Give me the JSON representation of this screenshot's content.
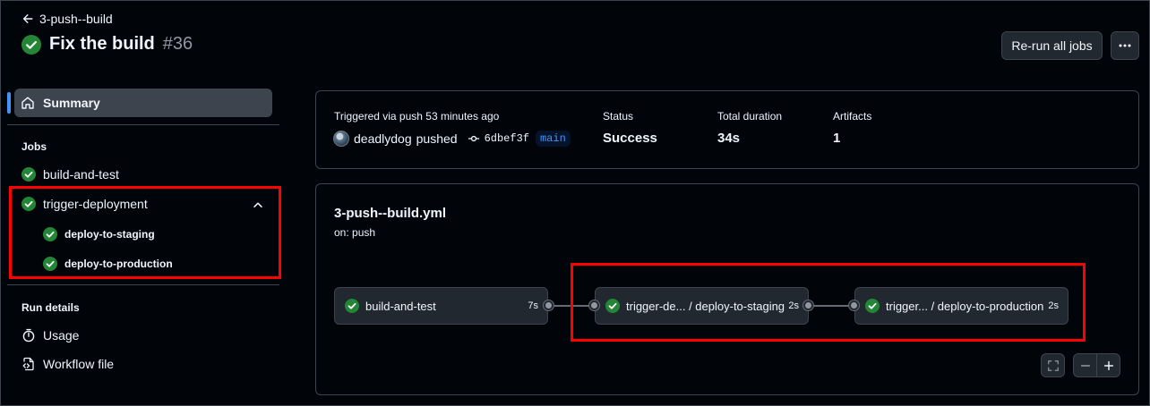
{
  "header": {
    "back_label": "3-push--build",
    "title": "Fix the build",
    "run_number": "#36",
    "rerun_label": "Re-run all jobs",
    "more_label": "···"
  },
  "sidebar": {
    "summary_label": "Summary",
    "jobs_heading": "Jobs",
    "jobs": [
      {
        "label": "build-and-test",
        "status": "success"
      },
      {
        "label": "trigger-deployment",
        "status": "success",
        "expanded": true,
        "children": [
          {
            "label": "deploy-to-staging",
            "status": "success"
          },
          {
            "label": "deploy-to-production",
            "status": "success"
          }
        ]
      }
    ],
    "run_details_heading": "Run details",
    "details": [
      {
        "label": "Usage",
        "icon": "stopwatch-icon"
      },
      {
        "label": "Workflow file",
        "icon": "file-code-icon"
      }
    ]
  },
  "summary_card": {
    "trigger_text": "Triggered via push 53 minutes ago",
    "actor": "deadlydog",
    "action": "pushed",
    "commit_sha": "6dbef3f",
    "branch": "main",
    "status_label": "Status",
    "status_value": "Success",
    "duration_label": "Total duration",
    "duration_value": "34s",
    "artifacts_label": "Artifacts",
    "artifacts_value": "1"
  },
  "graph": {
    "workflow_file": "3-push--build.yml",
    "trigger": "on: push",
    "nodes": [
      {
        "label": "build-and-test",
        "duration": "7s",
        "status": "success"
      },
      {
        "label": "trigger-de... / deploy-to-staging",
        "duration": "2s",
        "status": "success"
      },
      {
        "label": "trigger... / deploy-to-production",
        "duration": "2s",
        "status": "success"
      }
    ]
  },
  "colors": {
    "background": "#010409",
    "success": "#238636",
    "border": "#3d444d",
    "accent": "#4493f8",
    "annotation": "#ff0000"
  }
}
